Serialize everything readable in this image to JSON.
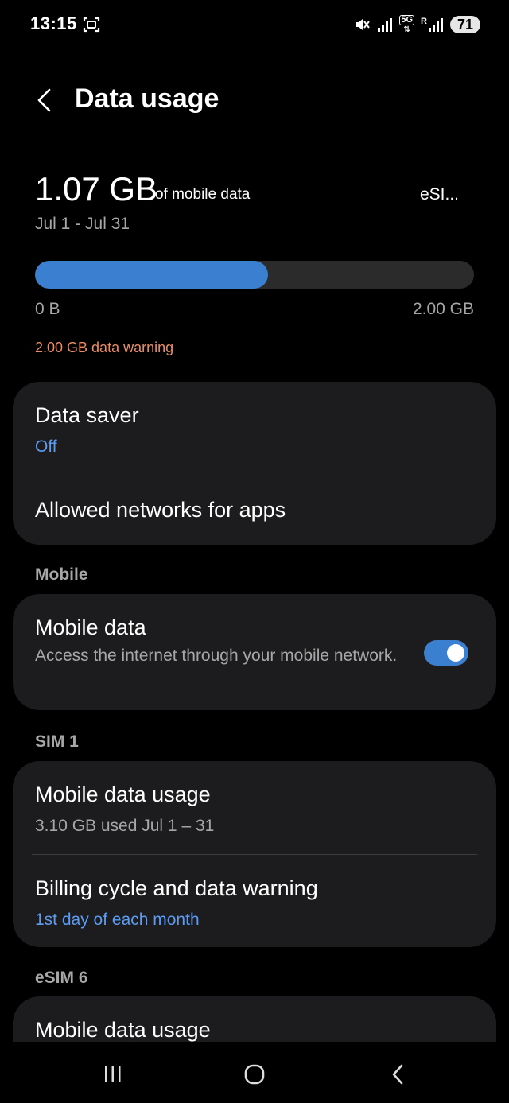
{
  "status_bar": {
    "time": "13:15",
    "network": "5G",
    "roaming": "R",
    "battery": "71"
  },
  "header": {
    "title": "Data usage"
  },
  "usage": {
    "amount": "1.07 GB",
    "suffix": "of mobile data",
    "sim": "eSI...",
    "period": "Jul 1 - Jul 31",
    "progress_fraction": 0.53,
    "min_label": "0 B",
    "max_label": "2.00 GB",
    "warning": "2.00 GB data warning"
  },
  "card1": {
    "data_saver_title": "Data saver",
    "data_saver_value": "Off",
    "allowed_networks": "Allowed networks for apps"
  },
  "section_mobile": "Mobile",
  "mobile_data": {
    "title": "Mobile data",
    "desc": "Access the internet through your mobile network.",
    "enabled": true
  },
  "section_sim1": "SIM 1",
  "sim1": {
    "usage_title": "Mobile data usage",
    "usage_sub": "3.10 GB used Jul 1 – 31",
    "billing_title": "Billing cycle and data warning",
    "billing_sub": "1st day of each month"
  },
  "section_esim": "eSIM 6",
  "esim": {
    "usage_title": "Mobile data usage"
  },
  "colors": {
    "accent": "#3b80d0",
    "link": "#5c9cf2",
    "warning": "#ea8d67",
    "card": "#1c1c1e"
  }
}
